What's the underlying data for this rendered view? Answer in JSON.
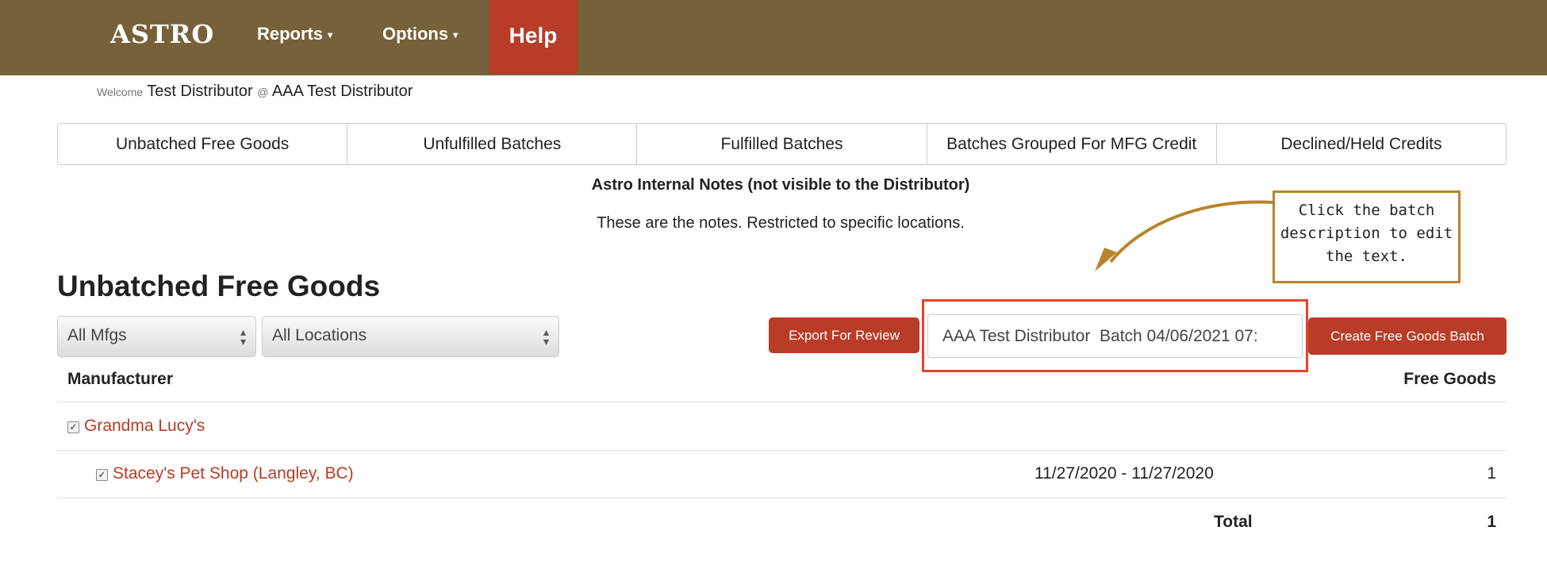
{
  "nav": {
    "logo": "ASTRO",
    "reports": "Reports",
    "options": "Options",
    "help": "Help",
    "caret": "▾"
  },
  "welcome": {
    "prefix": "Welcome",
    "user": "Test Distributor",
    "at": "@",
    "company": "AAA Test Distributor"
  },
  "tabs": [
    "Unbatched Free Goods",
    "Unfulfilled Batches",
    "Fulfilled Batches",
    "Batches Grouped For MFG Credit",
    "Declined/Held Credits"
  ],
  "notes": {
    "title": "Astro Internal Notes (not visible to the Distributor)",
    "text": "These are the notes. Restricted to specific locations."
  },
  "page_title": "Unbatched Free Goods",
  "filters": {
    "mfg": "All Mfgs",
    "location": "All Locations"
  },
  "actions": {
    "export": "Export For Review",
    "batch_description": "AAA Test Distributor  Batch 04/06/2021 07:",
    "create": "Create Free Goods Batch"
  },
  "callout": {
    "text": "Click the batch description to edit the text."
  },
  "table": {
    "col_manufacturer": "Manufacturer",
    "col_free_goods": "Free Goods",
    "manufacturer": "Grandma Lucy's",
    "location": {
      "name": "Stacey's Pet Shop (Langley, BC)",
      "dates": "11/27/2020 - 11/27/2020",
      "count": "1"
    },
    "total_label": "Total",
    "total": "1"
  },
  "colors": {
    "nav": "#77613a",
    "accent": "#b83c27",
    "highlight": "#e8432e",
    "callout": "#b9842b"
  }
}
